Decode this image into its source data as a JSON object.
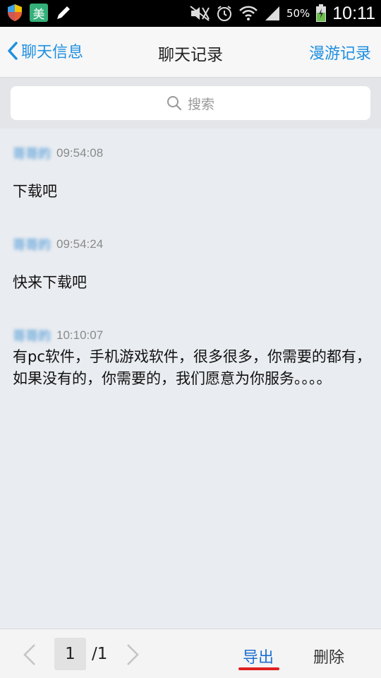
{
  "statusbar": {
    "app_badge": "美",
    "battery": "50%",
    "clock": "10:11",
    "icons": [
      "shield-icon",
      "app-badge-icon",
      "pen-icon",
      "mute-icon",
      "alarm-icon",
      "wifi-icon",
      "signal-icon",
      "battery-icon"
    ]
  },
  "header": {
    "back_label": "聊天信息",
    "title": "聊天记录",
    "roam_label": "漫游记录"
  },
  "search": {
    "placeholder": "搜索"
  },
  "messages": [
    {
      "sender": "哥哥的",
      "time": "09:54:08",
      "text": "下载吧"
    },
    {
      "sender": "哥哥的",
      "time": "09:54:24",
      "text": "快来下载吧"
    },
    {
      "sender": "哥哥的",
      "time": "10:10:07",
      "text": "有pc软件，手机游戏软件，很多很多，你需要的都有，如果没有的，你需要的，我们愿意为你服务。。。。"
    }
  ],
  "pagination": {
    "current": "1",
    "total": "/1"
  },
  "actions": {
    "export_label": "导出",
    "delete_label": "删除"
  },
  "colors": {
    "accent": "#1e8fe0",
    "background": "#e9ecf0",
    "sender": "#3a8fd6"
  }
}
